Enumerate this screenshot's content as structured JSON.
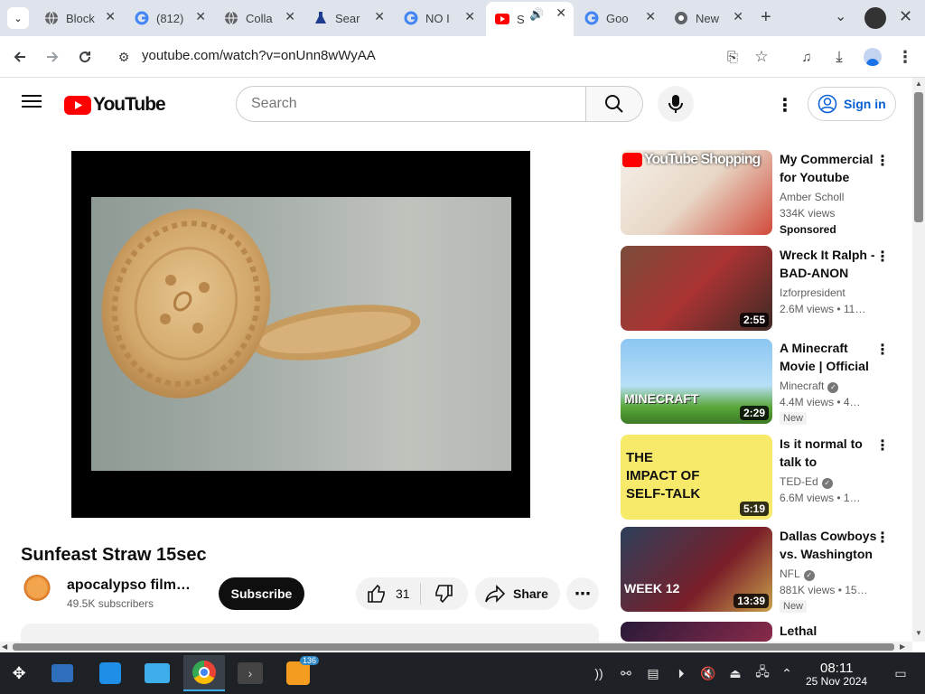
{
  "browser": {
    "tabs": [
      {
        "title": "Block",
        "icon": "globe-icon"
      },
      {
        "title": "(812)",
        "icon": "google-icon"
      },
      {
        "title": "Colla",
        "icon": "globe-icon"
      },
      {
        "title": "Sear",
        "icon": "flask-icon"
      },
      {
        "title": "NO I",
        "icon": "google-icon"
      },
      {
        "title": "S",
        "icon": "youtube-icon",
        "active": true,
        "audio": true
      },
      {
        "title": "Goo",
        "icon": "google-icon"
      },
      {
        "title": "New",
        "icon": "chrome-icon"
      }
    ],
    "url": "youtube.com/watch?v=onUnn8wWyAA"
  },
  "youtube": {
    "logo_text": "YouTube",
    "search_placeholder": "Search",
    "signin_label": "Sign in",
    "video": {
      "title": "Sunfeast Straw 15sec",
      "channel": "apocalypso filmworks",
      "subscribers": "49.5K subscribers",
      "subscribe_label": "Subscribe",
      "likes": "31",
      "share_label": "Share"
    },
    "recommendations": [
      {
        "title": "My Commercial for Youtube Shopping",
        "channel": "Amber Scholl",
        "views": "334K views",
        "extra": "Sponsored",
        "thumb_text": "YouTube Shopping"
      },
      {
        "title": "Wreck It Ralph - BAD-ANON",
        "channel": "Izforpresident",
        "views": "2.6M views • 11…",
        "duration": "2:55"
      },
      {
        "title": "A Minecraft Movie | Official Trailer",
        "channel": "Minecraft",
        "verified": true,
        "views": "4.4M views • 4…",
        "badge": "New",
        "duration": "2:29",
        "thumb_text": "MINECRAFT"
      },
      {
        "title": "Is it normal to talk to yourself?",
        "channel": "TED-Ed",
        "verified": true,
        "views": "6.6M views • 1…",
        "duration": "5:19",
        "thumb_text": "THE IMPACT OF SELF-TALK"
      },
      {
        "title": "Dallas Cowboys vs. Washington Commanders",
        "channel": "NFL",
        "verified": true,
        "views": "881K views • 15…",
        "badge": "New",
        "duration": "13:39",
        "thumb_text": "WEEK 12"
      },
      {
        "title": "Lethal"
      }
    ]
  },
  "taskbar": {
    "time": "08:11",
    "date": "25 Nov 2024",
    "rss_badge": "136"
  }
}
